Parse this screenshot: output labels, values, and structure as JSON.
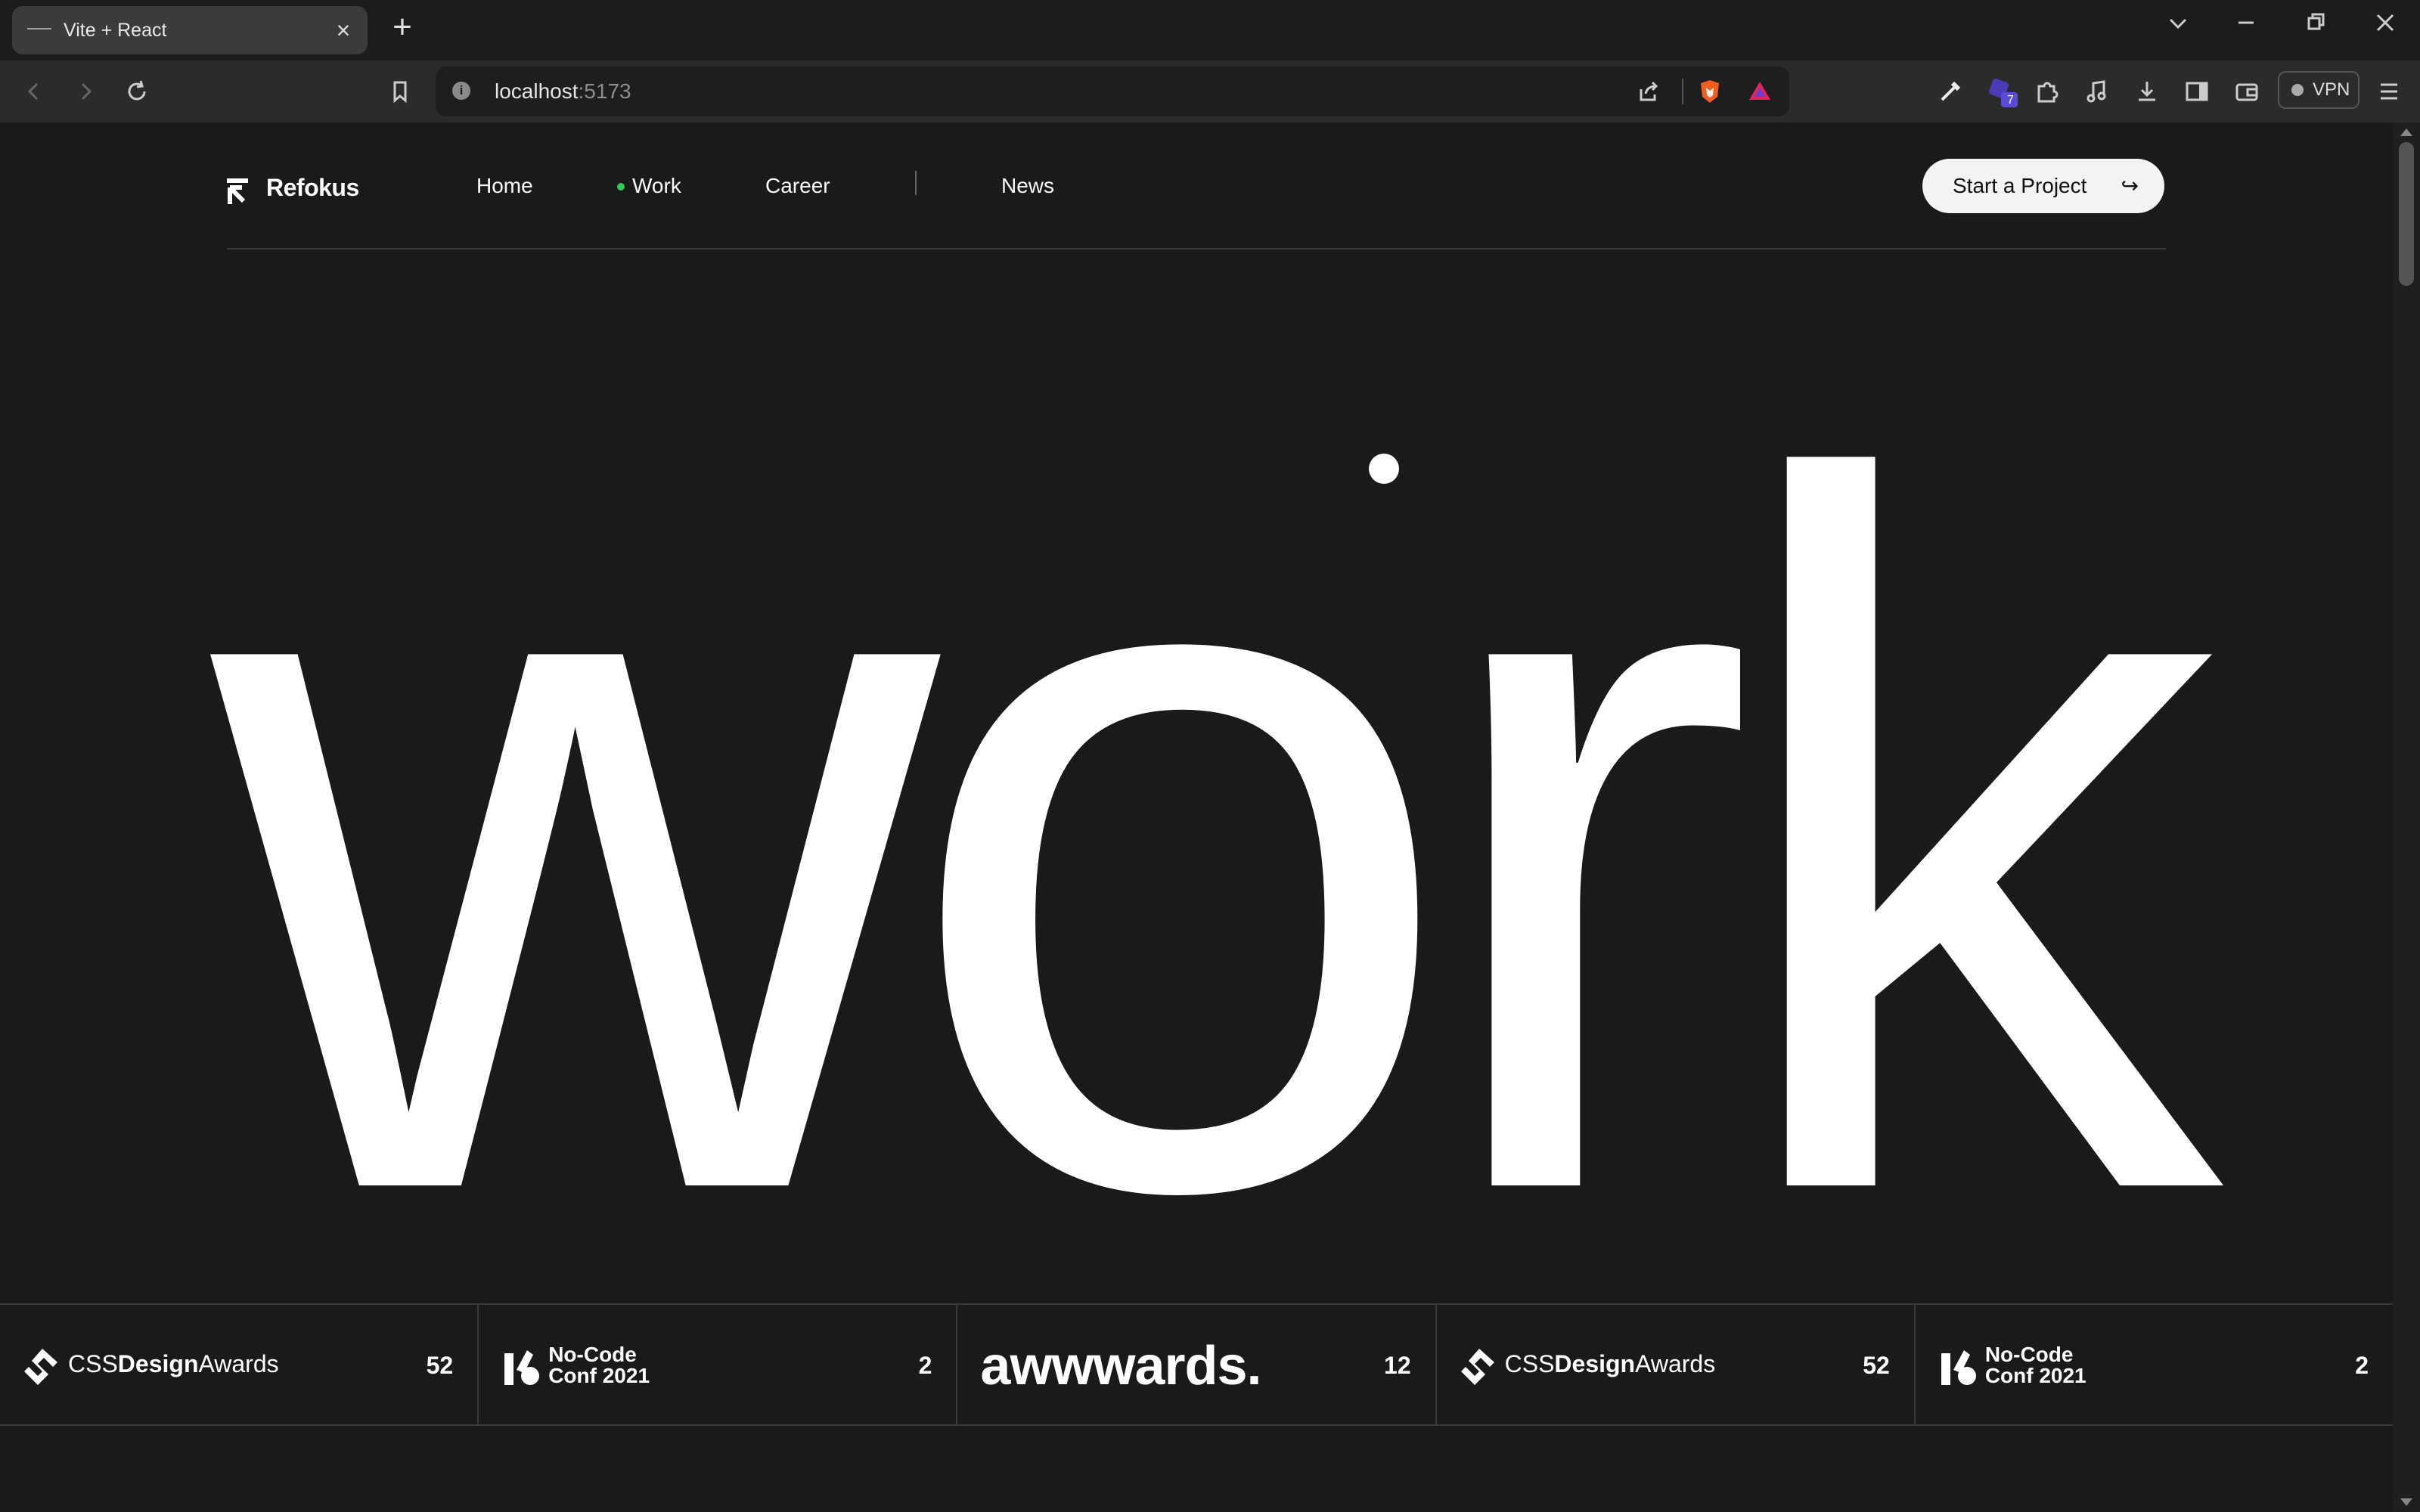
{
  "browser": {
    "tab_title": "Vite + React",
    "url_host": "localhost",
    "url_port": ":5173",
    "vpn_label": "VPN",
    "extension_badge": "7"
  },
  "nav": {
    "brand": "Refokus",
    "links": [
      "Home",
      "Work",
      "Career",
      "News"
    ],
    "active_link": "Work",
    "cta_label": "Start a Project",
    "cta_arrow": "↪"
  },
  "hero": {
    "word": "work"
  },
  "awards": [
    {
      "name_light": "CSS",
      "name_bold": "Design",
      "name_rest": "Awards",
      "count": "52",
      "icon": "css-design-awards-icon"
    },
    {
      "line1": "No-Code",
      "line2": "Conf 2021",
      "count": "2",
      "icon": "no-code-conf-icon"
    },
    {
      "name": "awwwards.",
      "count": "12",
      "icon": "none"
    },
    {
      "name_light": "CSS",
      "name_bold": "Design",
      "name_rest": "Awards",
      "count": "52",
      "icon": "css-design-awards-icon"
    },
    {
      "line1": "No-Code",
      "line2": "Conf 2021",
      "count": "2",
      "icon": "no-code-conf-icon"
    }
  ],
  "colors": {
    "background": "#1a1a1b",
    "active_dot": "#35c759",
    "cta_bg": "#f3f3f3"
  }
}
